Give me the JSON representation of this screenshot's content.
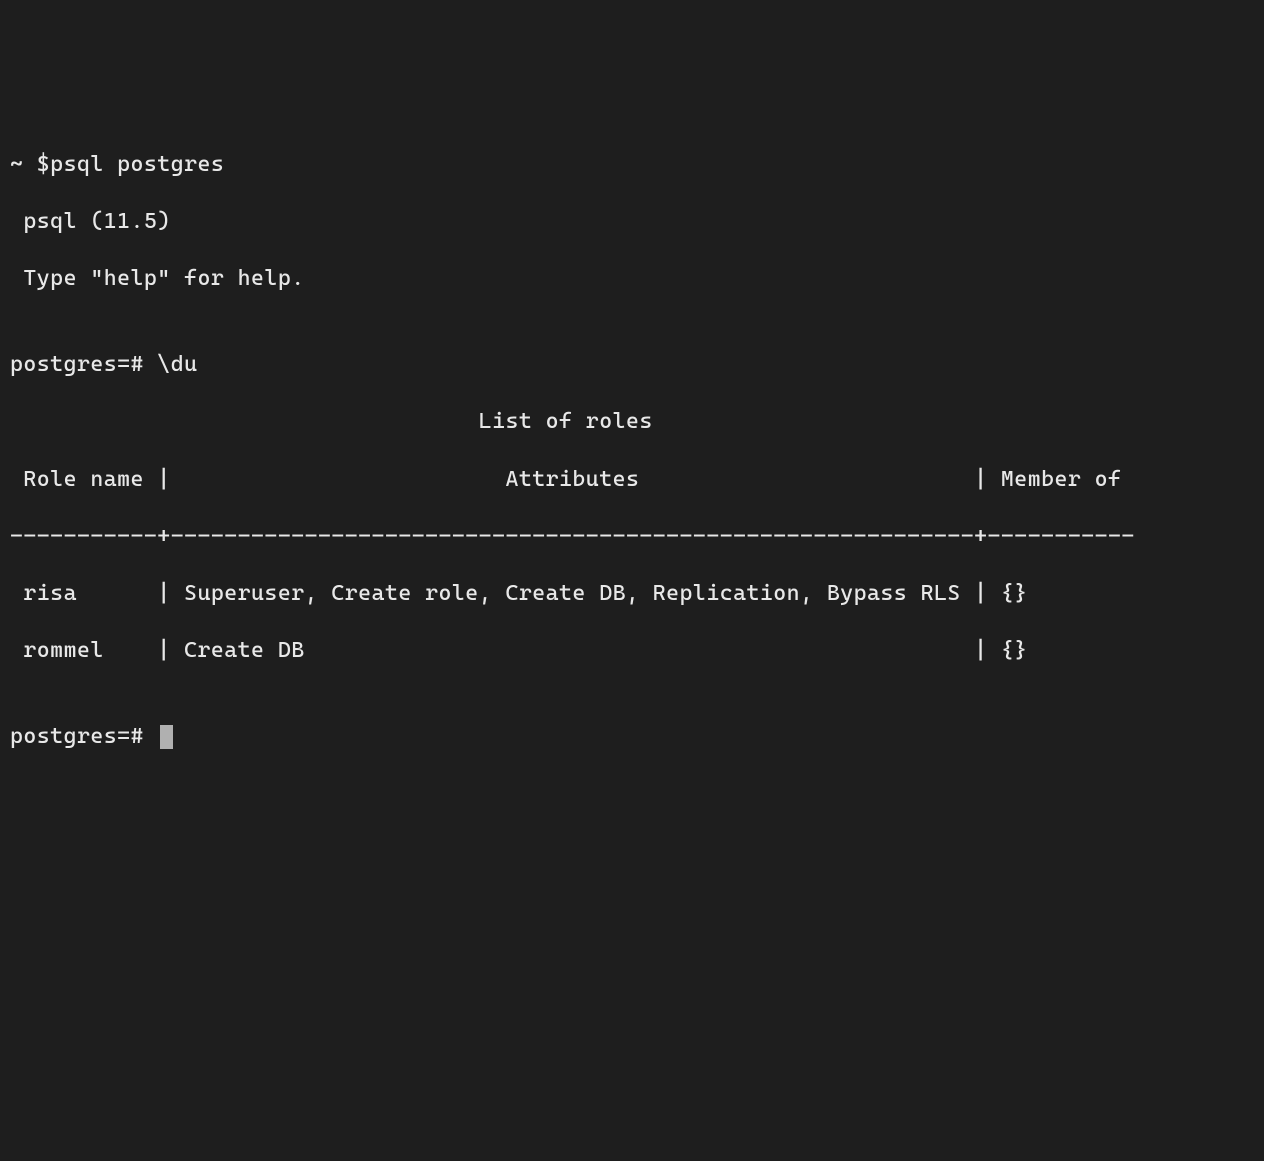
{
  "shell_prompt": "~ $",
  "shell_command": "psql postgres",
  "psql_version": " psql (11.5)",
  "psql_help": " Type \"help\" for help.",
  "blank": "",
  "psql_prompt_1": "postgres=# ",
  "psql_command_1": "\\du",
  "table_title": "                                   List of roles",
  "table_header": " Role name |                         Attributes                         | Member of ",
  "table_divider": "-----------+------------------------------------------------------------+-----------",
  "table_row_1": " risa      | Superuser, Create role, Create DB, Replication, Bypass RLS | {}",
  "table_row_2": " rommel    | Create DB                                                  | {}",
  "psql_prompt_2": "postgres=# ",
  "roles": [
    {
      "name": "risa",
      "attributes": "Superuser, Create role, Create DB, Replication, Bypass RLS",
      "member_of": "{}"
    },
    {
      "name": "rommel",
      "attributes": "Create DB",
      "member_of": "{}"
    }
  ]
}
